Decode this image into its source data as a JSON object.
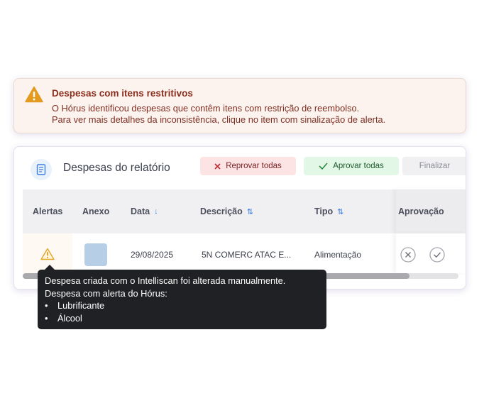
{
  "alert": {
    "title": "Despesas com itens restritivos",
    "line1": "O Hórus identificou despesas que contêm itens com restrição de reembolso.",
    "line2": "Para ver mais detalhes da inconsistência, clique no item com sinalização de alerta.",
    "icon": "warning-triangle-icon",
    "color": "#e39a1f"
  },
  "report": {
    "title": "Despesas do relatório",
    "buttons": {
      "reject_all": "Reprovar todas",
      "approve_all": "Aprovar todas",
      "finalize": "Finalizar"
    },
    "columns": {
      "alerts": "Alertas",
      "attachment": "Anexo",
      "date": "Data",
      "description": "Descrição",
      "type": "Tipo",
      "approval": "Aprovação"
    },
    "rows": [
      {
        "date": "29/08/2025",
        "description": "5N COMERC ATAC E...",
        "type": "Alimentação"
      }
    ]
  },
  "tooltip": {
    "line1": "Despesa criada com o Intelliscan foi alterada manualmente.",
    "line2": "Despesa com alerta do Hórus:",
    "items": [
      "Lubrificante",
      "Álcool"
    ]
  },
  "colors": {
    "accent": "#3d7ee0",
    "reject_bg": "#fde4e4",
    "approve_bg": "#e3f7e6",
    "warning": "#e39a1f"
  }
}
